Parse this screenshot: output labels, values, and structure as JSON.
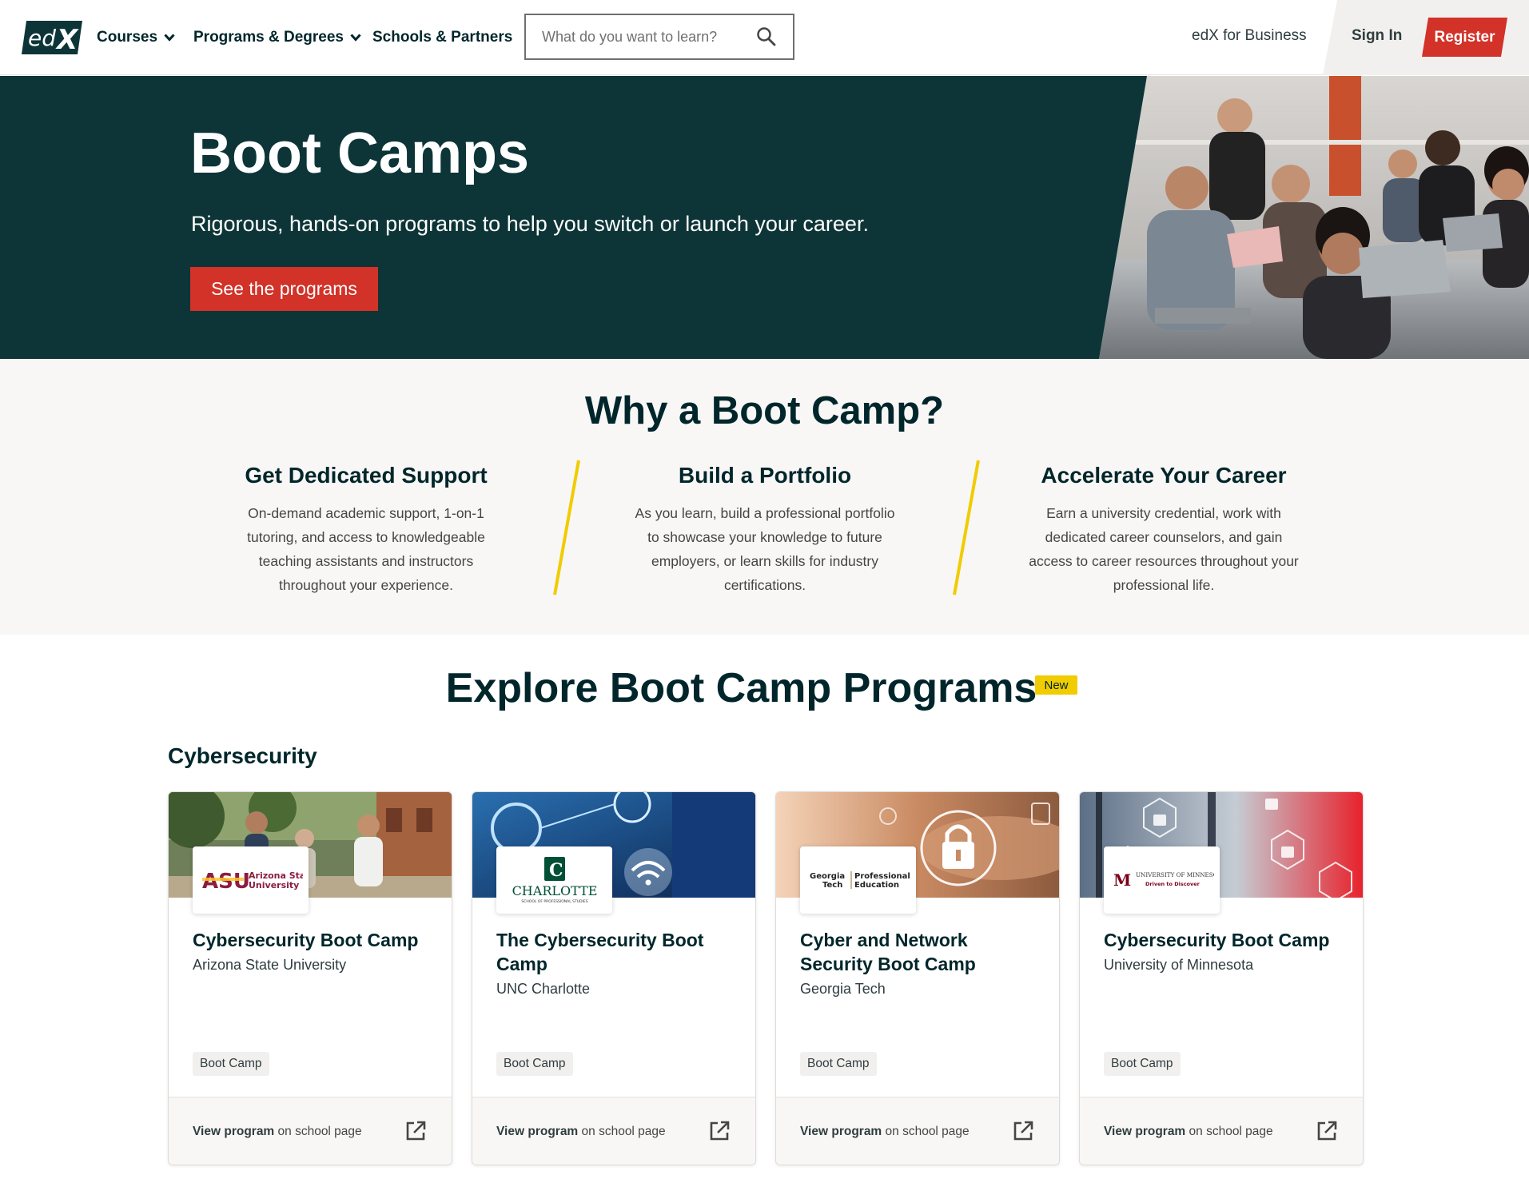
{
  "header": {
    "logo_text": "edX",
    "nav": [
      {
        "label": "Courses",
        "has_dropdown": true
      },
      {
        "label": "Programs & Degrees",
        "has_dropdown": true
      },
      {
        "label": "Schools & Partners",
        "has_dropdown": false
      }
    ],
    "search_placeholder": "What do you want to learn?",
    "business_link": "edX for Business",
    "sign_in": "Sign In",
    "register": "Register",
    "colors": {
      "accent": "#d23228",
      "text": "#00262b"
    }
  },
  "hero": {
    "title": "Boot Camps",
    "subtitle": "Rigorous, hands-on programs to help you switch or launch your career.",
    "cta": "See the programs",
    "background": "#0d3537"
  },
  "why": {
    "title": "Why a Boot Camp?",
    "columns": [
      {
        "heading": "Get Dedicated Support",
        "text": "On-demand academic support, 1-on-1 tutoring, and access to knowledgeable teaching assistants and instructors throughout your experience."
      },
      {
        "heading": "Build a Portfolio",
        "text": "As you learn, build a professional portfolio to showcase your knowledge to future employers, or learn skills for industry certifications."
      },
      {
        "heading": "Accelerate Your Career",
        "text": "Earn a university credential, work with dedicated career counselors, and gain access to career resources throughout your professional life."
      }
    ],
    "divider_color": "#f0cc00"
  },
  "explore": {
    "title": "Explore Boot Camp Programs",
    "badge": "New",
    "category": "Cybersecurity",
    "cards": [
      {
        "title": "Cybersecurity Boot Camp",
        "school": "Arizona State University",
        "logo_text": "ASU",
        "logo_sub": "Arizona State University",
        "tag": "Boot Camp",
        "link_bold": "View program",
        "link_rest": " on school page"
      },
      {
        "title": "The Cybersecurity Boot Camp",
        "school": "UNC Charlotte",
        "logo_text": "CHARLOTTE",
        "logo_sub": "SCHOOL OF PROFESSIONAL STUDIES",
        "tag": "Boot Camp",
        "link_bold": "View program",
        "link_rest": " on school page"
      },
      {
        "title": "Cyber and Network Security Boot Camp",
        "school": "Georgia Tech",
        "logo_text": "Georgia Tech",
        "logo_sub": "Professional Education",
        "tag": "Boot Camp",
        "link_bold": "View program",
        "link_rest": " on school page"
      },
      {
        "title": "Cybersecurity Boot Camp",
        "school": "University of Minnesota",
        "logo_text": "University of Minnesota",
        "logo_sub": "Driven to Discover",
        "tag": "Boot Camp",
        "link_bold": "View program",
        "link_rest": " on school page"
      }
    ]
  }
}
